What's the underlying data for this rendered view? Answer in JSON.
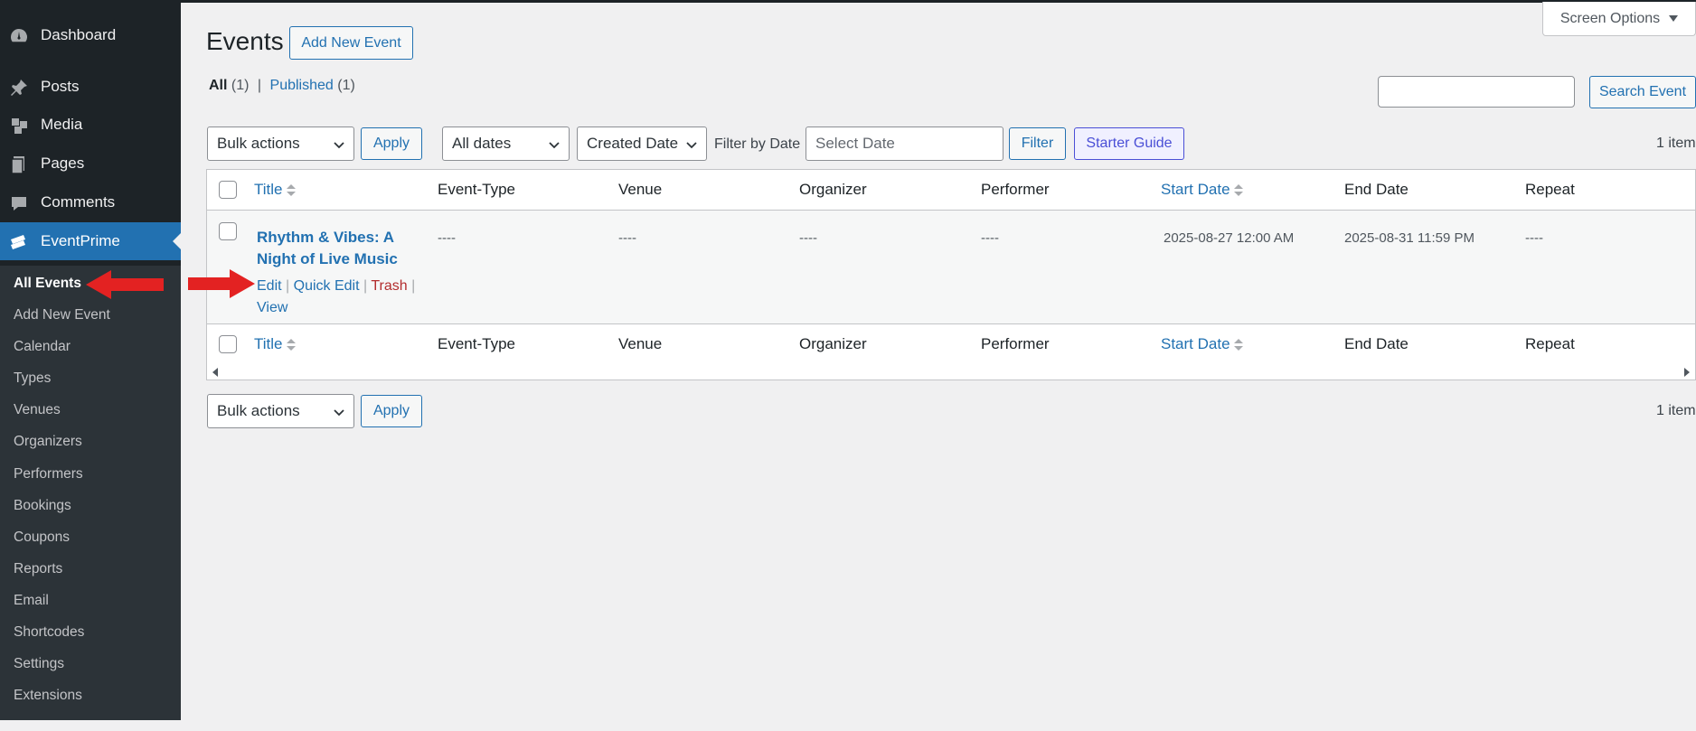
{
  "sidebar": {
    "top_items": [
      {
        "label": "Dashboard",
        "icon": "dashboard-icon"
      },
      {
        "label": "Posts",
        "icon": "pushpin-icon"
      },
      {
        "label": "Media",
        "icon": "media-icon"
      },
      {
        "label": "Pages",
        "icon": "pages-icon"
      },
      {
        "label": "Comments",
        "icon": "comment-icon"
      },
      {
        "label": "EventPrime",
        "icon": "eventprime-icon",
        "current": true
      }
    ],
    "sub_items": [
      {
        "label": "All Events",
        "current": true
      },
      {
        "label": "Add New Event"
      },
      {
        "label": "Calendar"
      },
      {
        "label": "Types"
      },
      {
        "label": "Venues"
      },
      {
        "label": "Organizers"
      },
      {
        "label": "Performers"
      },
      {
        "label": "Bookings"
      },
      {
        "label": "Coupons"
      },
      {
        "label": "Reports"
      },
      {
        "label": "Email"
      },
      {
        "label": "Shortcodes"
      },
      {
        "label": "Settings"
      },
      {
        "label": "Extensions"
      }
    ]
  },
  "header": {
    "screen_options_label": "Screen Options",
    "page_title": "Events",
    "add_new_label": "Add New Event"
  },
  "views": {
    "all_label": "All",
    "all_count": "(1)",
    "separator": "|",
    "published_label": "Published",
    "published_count": "(1)"
  },
  "search": {
    "value": "",
    "button_label": "Search Event"
  },
  "tablenav_top": {
    "bulk_actions": "Bulk actions",
    "apply_label": "Apply",
    "dates_select": "All dates",
    "sort_select": "Created Date",
    "filter_by_date_label": "Filter by Date",
    "date_placeholder": "Select Date",
    "filter_label": "Filter",
    "starter_guide_label": "Starter Guide",
    "items_count": "1 item"
  },
  "table": {
    "columns": [
      "Title",
      "Event-Type",
      "Venue",
      "Organizer",
      "Performer",
      "Start Date",
      "End Date",
      "Repeat"
    ],
    "rows": [
      {
        "title": "Rhythm & Vibes: A Night of Live Music",
        "event_type": "----",
        "venue": "----",
        "organizer": "----",
        "performer": "----",
        "start_date": "2025-08-27 12:00 AM",
        "end_date": "2025-08-31 11:59 PM",
        "repeat": "----",
        "actions": {
          "edit": "Edit",
          "quick_edit": "Quick Edit",
          "trash": "Trash",
          "view": "View",
          "sep": "|"
        }
      }
    ]
  },
  "tablenav_bottom": {
    "bulk_actions": "Bulk actions",
    "apply_label": "Apply",
    "items_count": "1 item"
  },
  "colors": {
    "sidebar_bg": "#1d2327",
    "submenu_bg": "#2c3338",
    "accent": "#2271b1",
    "trash": "#b32d2e",
    "annotation_arrow": "#e32222"
  }
}
